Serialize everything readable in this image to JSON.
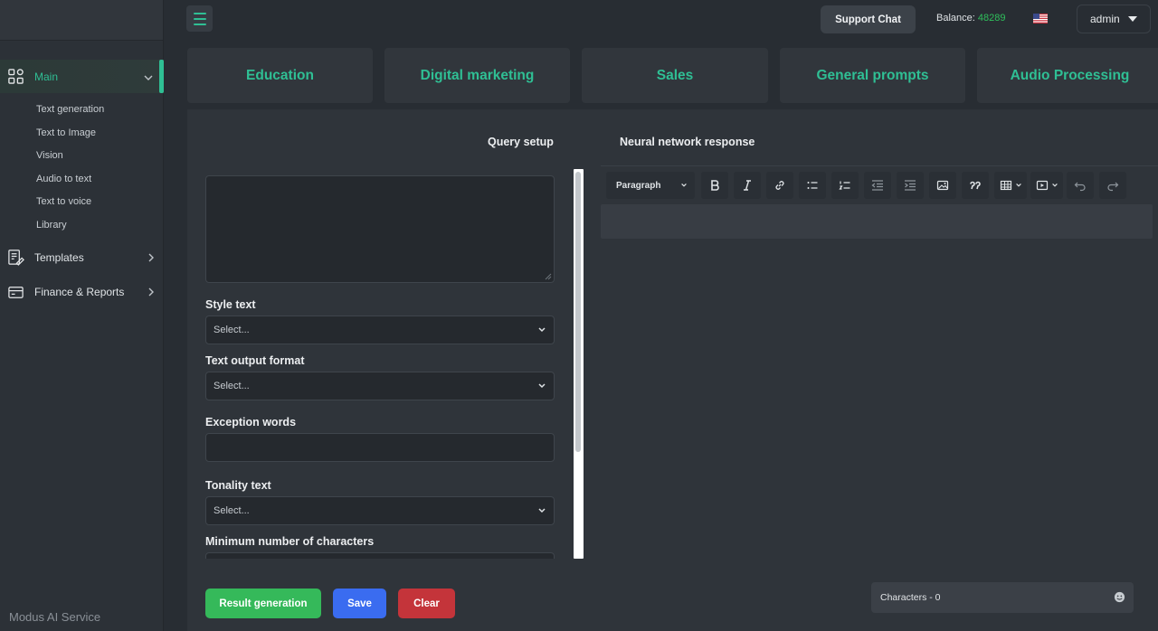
{
  "brand": "Modus AI Service",
  "sidebar": {
    "main": {
      "label": "Main"
    },
    "sub_items": [
      "Text generation",
      "Text to Image",
      "Vision",
      "Audio to text",
      "Text to voice",
      "Library"
    ],
    "templates": {
      "label": "Templates"
    },
    "finance": {
      "label": "Finance & Reports"
    }
  },
  "header": {
    "support_label": "Support Chat",
    "balance_label": "Balance:",
    "balance_value": "48289",
    "user_label": "admin"
  },
  "tabs": [
    "Education",
    "Digital marketing",
    "Sales",
    "General prompts",
    "Audio Processing"
  ],
  "query": {
    "title": "Query setup",
    "style_label": "Style text",
    "style_value": "Select...",
    "format_label": "Text output format",
    "format_value": "Select...",
    "exception_label": "Exception words",
    "tonality_label": "Tonality text",
    "tonality_value": "Select...",
    "min_chars_label": "Minimum number of characters"
  },
  "response": {
    "title": "Neural network response",
    "paragraph_label": "Paragraph"
  },
  "actions": {
    "generate_label": "Result generation",
    "save_label": "Save",
    "clear_label": "Clear"
  },
  "characters_label": "Characters - 0",
  "colors": {
    "accent": "#2fbf94",
    "balance": "#2fbf5c",
    "generate": "#35b95a",
    "save": "#3a6cf0",
    "clear": "#c4343a"
  }
}
